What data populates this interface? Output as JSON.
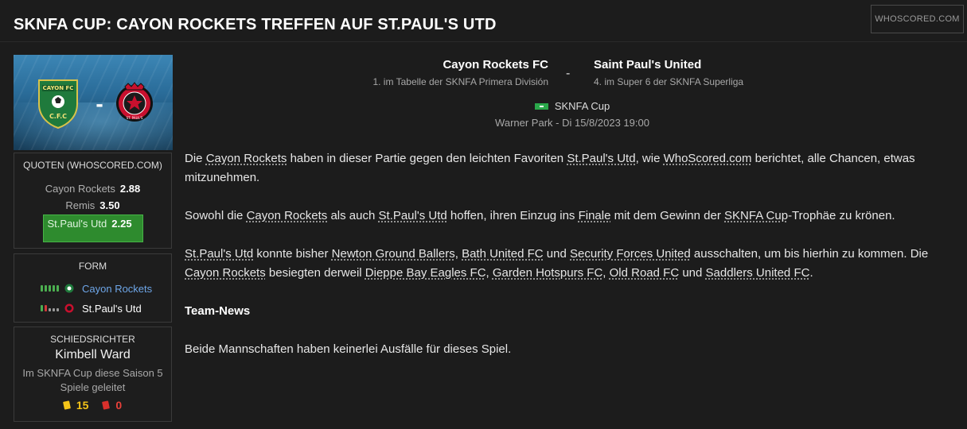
{
  "header": {
    "title": "SKNFA CUP: CAYON ROCKETS TREFFEN AUF ST.PAUL'S UTD",
    "brand": "WHOSCORED.COM"
  },
  "banner": {
    "home_crest_text": "CAYON FC",
    "home_crest_initials": "C.F.C",
    "away_crest_text": "ST. PAUL'S",
    "separator": "-"
  },
  "odds": {
    "title": "QUOTEN (WHOSCORED.COM)",
    "rows": [
      {
        "label": "Cayon Rockets",
        "value": "2.88"
      },
      {
        "label": "Remis",
        "value": "3.50"
      }
    ],
    "favorite": {
      "label": "St.Paul's Utd",
      "value": "2.25"
    }
  },
  "form": {
    "title": "FORM",
    "home": {
      "team": "Cayon Rockets",
      "results": [
        "W",
        "W",
        "W",
        "W",
        "W"
      ]
    },
    "away": {
      "team": "St.Paul's Utd",
      "results": [
        "W",
        "L",
        "D",
        "D",
        "D"
      ]
    }
  },
  "referee": {
    "title": "SCHIEDSRICHTER",
    "name": "Kimbell Ward",
    "stat": "Im SKNFA Cup diese Saison 5 Spiele geleitet",
    "yellow": "15",
    "red": "0"
  },
  "match": {
    "home_team": "Cayon Rockets FC",
    "home_sub": "1. im Tabelle der SKNFA Primera División",
    "separator": "-",
    "away_team": "Saint Paul's United",
    "away_sub": "4. im Super 6 der SKNFA Superliga",
    "competition": "SKNFA Cup",
    "venue": "Warner Park - Di 15/8/2023 19:00"
  },
  "article": {
    "p1": [
      "Die ",
      "Cayon Rockets",
      " haben in dieser Partie gegen den leichten Favoriten ",
      "St.Paul's Utd",
      ", wie ",
      "WhoScored.com",
      " berichtet, alle Chancen, etwas mitzunehmen."
    ],
    "p2": [
      "Sowohl die ",
      "Cayon Rockets",
      " als auch ",
      "St.Paul's Utd",
      " hoffen, ihren Einzug ins ",
      "Finale",
      " mit dem Gewinn der ",
      "SKNFA Cup",
      "-Trophäe zu krönen."
    ],
    "p3": [
      "St.Paul's Utd",
      " konnte bisher ",
      "Newton Ground Ballers",
      ", ",
      "Bath United FC",
      " und ",
      "Security Forces United",
      " ausschalten, um bis hierhin zu kommen. Die ",
      "Cayon Rockets",
      " besiegten derweil ",
      "Dieppe Bay Eagles FC",
      ", ",
      "Garden Hotspurs FC",
      ", ",
      "Old Road FC",
      " und ",
      "Saddlers United FC",
      "."
    ],
    "heading": "Team-News",
    "p4": "Beide Mannschaften haben keinerlei Ausfälle für dieses Spiel."
  },
  "colors": {
    "background": "#1c1c1c",
    "favorite_odds": "#2e8b2e",
    "home_form_link": "#6ea6e8",
    "yellow_card": "#f5c518",
    "red_card": "#d9302c"
  }
}
